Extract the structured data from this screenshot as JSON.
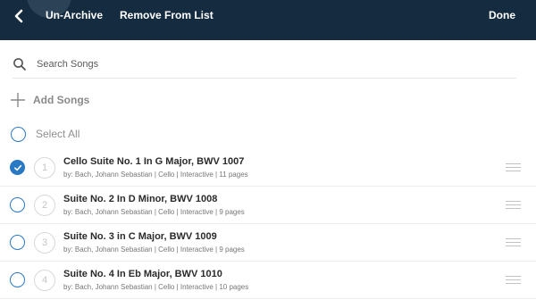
{
  "toolbar": {
    "back_icon": "chevron-left-icon",
    "unarchive_label": "Un-Archive",
    "remove_label": "Remove From List",
    "done_label": "Done",
    "background": "#142b40"
  },
  "search": {
    "icon": "search-icon",
    "placeholder": "Search Songs",
    "value": ""
  },
  "add_songs": {
    "icon": "plus-icon",
    "label": "Add Songs"
  },
  "select_all": {
    "label": "Select All",
    "checked": false
  },
  "accent_color": "#2a79c4",
  "songs": [
    {
      "number": "1",
      "title": "Cello Suite No. 1 In G Major, BWV 1007",
      "subtitle": "by: Bach, Johann Sebastian | Cello | Interactive | 11 pages",
      "checked": true
    },
    {
      "number": "2",
      "title": "Suite No. 2 In D Minor, BWV 1008",
      "subtitle": "by: Bach, Johann Sebastian | Cello | Interactive | 9 pages",
      "checked": false
    },
    {
      "number": "3",
      "title": "Suite No. 3 in C Major, BWV 1009",
      "subtitle": "by: Bach, Johann Sebastian | Cello | Interactive | 9 pages",
      "checked": false
    },
    {
      "number": "4",
      "title": "Suite No. 4 In Eb Major, BWV 1010",
      "subtitle": "by: Bach, Johann Sebastian | Cello | Interactive | 10 pages",
      "checked": false
    }
  ]
}
